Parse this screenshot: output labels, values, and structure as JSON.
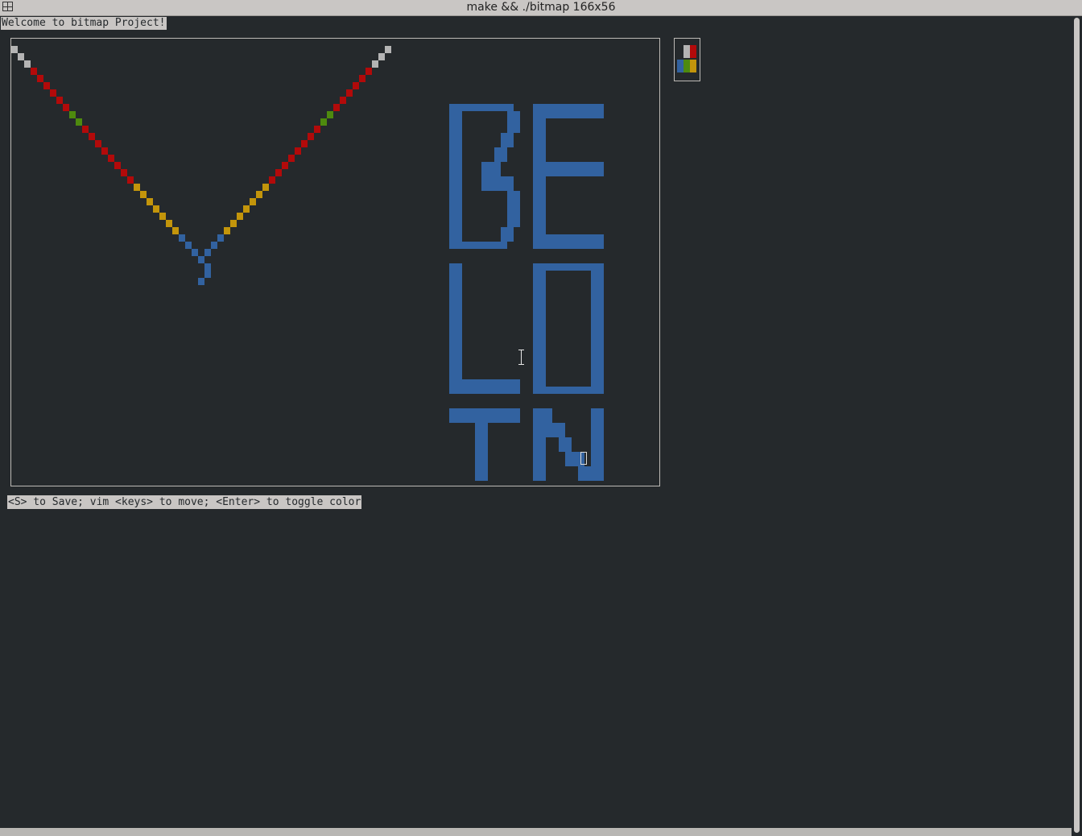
{
  "window": {
    "title": "make && ./bitmap 166x56"
  },
  "welcome_text": "Welcome to bitmap Project!",
  "help_text": "<S> to Save; vim <keys> to move; <Enter> to toggle color",
  "colors": {
    "background": "#25292c",
    "grey": "#b4b4b4",
    "red": "#b20a0a",
    "green": "#4e8a0e",
    "yellow": "#c3950b",
    "blue": "#3262a0"
  },
  "palette": {
    "swatches": [
      {
        "color": "grey"
      },
      {
        "color": "red"
      },
      {
        "color": "blue"
      },
      {
        "color": "green"
      },
      {
        "color": "yellow"
      }
    ]
  },
  "bitmap_text": "BELOTN",
  "v_shape_colors": [
    "grey",
    "grey",
    "grey",
    "red",
    "red",
    "red",
    "red",
    "red",
    "red",
    "green",
    "green",
    "red",
    "red",
    "red",
    "red",
    "red",
    "red",
    "red",
    "red",
    "yellow",
    "yellow",
    "yellow",
    "yellow",
    "yellow",
    "yellow",
    "yellow",
    "blue",
    "blue",
    "blue",
    "blue",
    "blue"
  ]
}
